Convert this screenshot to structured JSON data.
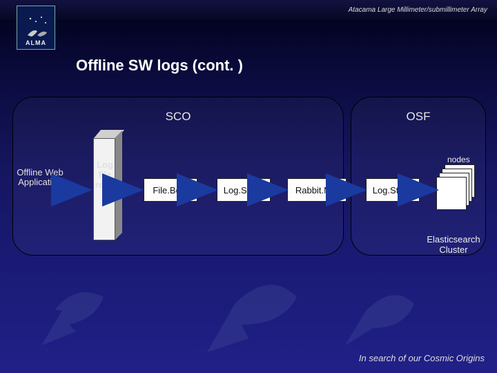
{
  "header": {
    "org": "Atacama Large Millimeter/submillimeter Array"
  },
  "logo": {
    "label": "ALMA"
  },
  "title": "Offline SW logs (cont. )",
  "regions": {
    "sco": "SCO",
    "osf": "OSF"
  },
  "nodes": {
    "offline_app": "Offline Web Application",
    "repo": "Log file repo",
    "filebeat": "File.Beat",
    "logstash1": "Log.Stash",
    "rabbitmq": "Rabbit.MQ",
    "logstash2": "Log.Stash",
    "es_nodes_label": "nodes",
    "es_cluster": "Elasticsearch Cluster"
  },
  "footer": "In search of our Cosmic Origins"
}
